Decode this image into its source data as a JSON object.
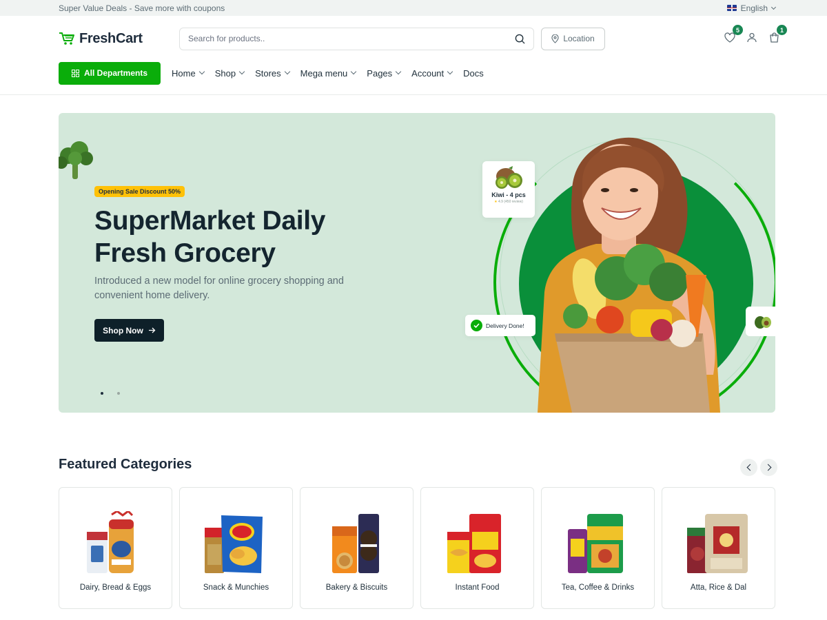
{
  "topbar": {
    "promo": "Super Value Deals - Save more with coupons",
    "language": "English"
  },
  "header": {
    "logo": "FreshCart",
    "search_placeholder": "Search for products..",
    "location_label": "Location",
    "wishlist_count": "5",
    "cart_count": "1"
  },
  "nav": {
    "departments_label": "All Departments",
    "items": [
      {
        "label": "Home",
        "has_dropdown": true
      },
      {
        "label": "Shop",
        "has_dropdown": true
      },
      {
        "label": "Stores",
        "has_dropdown": true
      },
      {
        "label": "Mega menu",
        "has_dropdown": true
      },
      {
        "label": "Pages",
        "has_dropdown": true
      },
      {
        "label": "Account",
        "has_dropdown": true
      },
      {
        "label": "Docs",
        "has_dropdown": false
      }
    ]
  },
  "hero": {
    "badge": "Opening Sale Discount 50%",
    "title_line1": "SuperMarket Daily",
    "title_line2": "Fresh Grocery",
    "subtitle": "Introduced a new model for online grocery shopping and convenient home delivery.",
    "cta_label": "Shop Now",
    "kiwi_label": "Kiwi - 4 pcs",
    "kiwi_rating": "4.9",
    "kiwi_reviews": "(450 review)",
    "delivery_label": "Delivery Done!",
    "slide_count": 2,
    "active_slide": 1
  },
  "categories": {
    "title": "Featured Categories",
    "items": [
      {
        "label": "Dairy, Bread & Eggs"
      },
      {
        "label": "Snack & Munchies"
      },
      {
        "label": "Bakery & Biscuits"
      },
      {
        "label": "Instant Food"
      },
      {
        "label": "Tea, Coffee & Drinks"
      },
      {
        "label": "Atta, Rice & Dal"
      }
    ]
  },
  "colors": {
    "primary": "#0aad0a",
    "dark": "#0e2029",
    "hero_bg": "#d3e8da",
    "badge": "#ffc107"
  }
}
